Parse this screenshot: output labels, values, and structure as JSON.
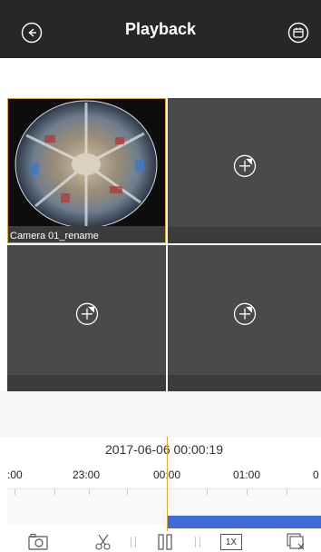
{
  "header": {
    "title": "Playback",
    "back_icon": "back-circle-icon",
    "calendar_icon": "calendar-icon"
  },
  "grid": {
    "cells": [
      {
        "camera_label": "Camera 01_rename"
      },
      {
        "empty": true
      },
      {
        "empty": true
      },
      {
        "empty": true
      }
    ]
  },
  "timeline": {
    "datetime": "2017-06-06  00:00:19",
    "labels": [
      ":00",
      "23:00",
      "00:00",
      "01:00",
      "0"
    ]
  },
  "toolbar": {
    "snapshot_icon": "camera-icon",
    "clip_icon": "scissors-icon",
    "pause_icon": "pause-icon",
    "speed_label": "1X",
    "close_all_icon": "close-windows-icon"
  },
  "colors": {
    "header_bg": "#272727",
    "selected_border": "#e3a72d",
    "recording": "#3f6bd8"
  }
}
